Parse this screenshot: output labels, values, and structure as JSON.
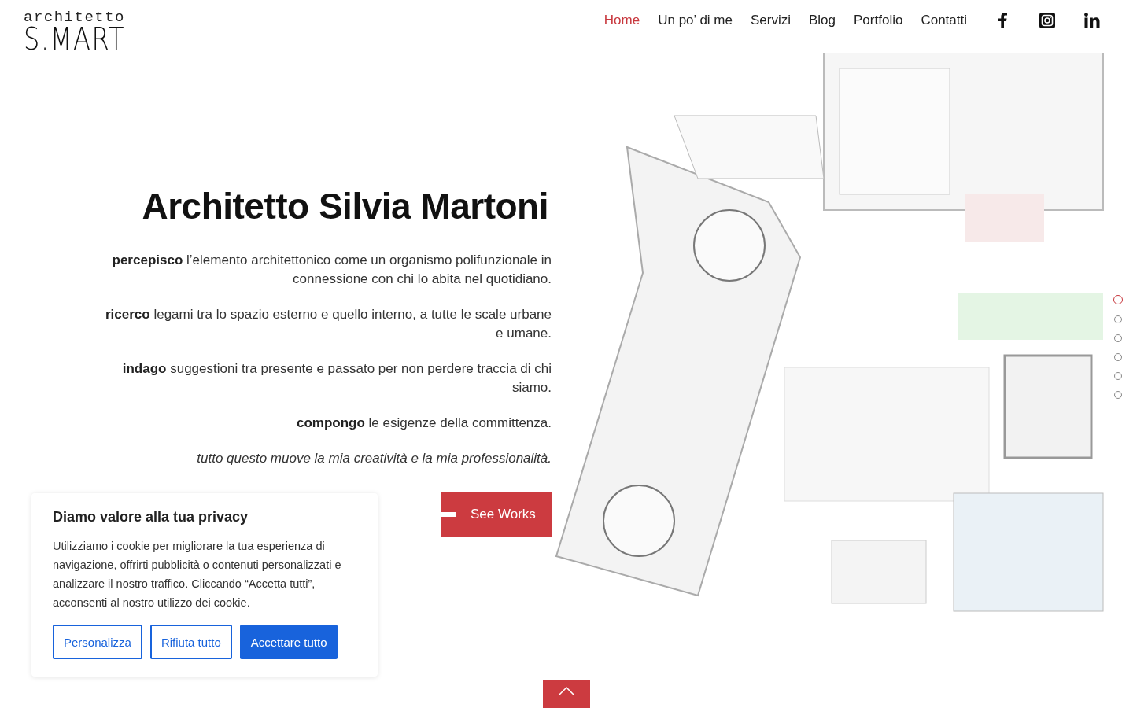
{
  "logo": {
    "line_1": "architetto",
    "line_2": "S.MART"
  },
  "nav": [
    {
      "label": "Home",
      "selected": true
    },
    {
      "label": "Un po’ di me",
      "selected": false
    },
    {
      "label": "Servizi",
      "selected": false
    },
    {
      "label": "Blog",
      "selected": false
    },
    {
      "label": "Portfolio",
      "selected": false
    },
    {
      "label": "Contatti",
      "selected": false
    }
  ],
  "social": [
    {
      "kind": "facebook"
    },
    {
      "kind": "instagram"
    },
    {
      "kind": "linkedin"
    }
  ],
  "hero": {
    "title": "Architetto Silvia Martoni",
    "paragraphs": [
      {
        "kind": "plain",
        "text": "**percepisco** l’elemento architettonico come un organismo polifunzionale in connessione con chi lo abita nel quotidiano."
      },
      {
        "kind": "plain",
        "text": "**ricerco** legami tra lo spazio esterno e quello interno, a tutte le scale urbane e umane."
      },
      {
        "kind": "plain",
        "text": "**indago** suggestioni tra presente e passato per non perdere traccia di chi siamo."
      },
      {
        "kind": "plain",
        "text": "**compongo** le esigenze della committenza."
      },
      {
        "kind": "italic",
        "text": "tutto questo muove la mia creatività e la mia professionalità."
      }
    ],
    "button": "See Works"
  },
  "slider_dots": [
    {
      "selected": true
    },
    {
      "selected": false
    },
    {
      "selected": false
    },
    {
      "selected": false
    },
    {
      "selected": false
    },
    {
      "selected": false
    }
  ],
  "cookie_banner": {
    "title": "Diamo valore alla tua privacy",
    "text": "Utilizziamo i cookie per migliorare la tua esperienza di navigazione, offrirti pubblicità o contenuti personalizzati e analizzare il nostro traffico. Cliccando “Accetta tutti”, acconsenti al nostro utilizzo dei cookie.",
    "buttons": [
      {
        "label": "Personalizza",
        "kind": "outline"
      },
      {
        "label": "Rifiuta tutto",
        "kind": "outline"
      },
      {
        "label": "Accettare tutto",
        "kind": "filled"
      }
    ]
  },
  "scroll_top": {
    "kind": "up"
  }
}
